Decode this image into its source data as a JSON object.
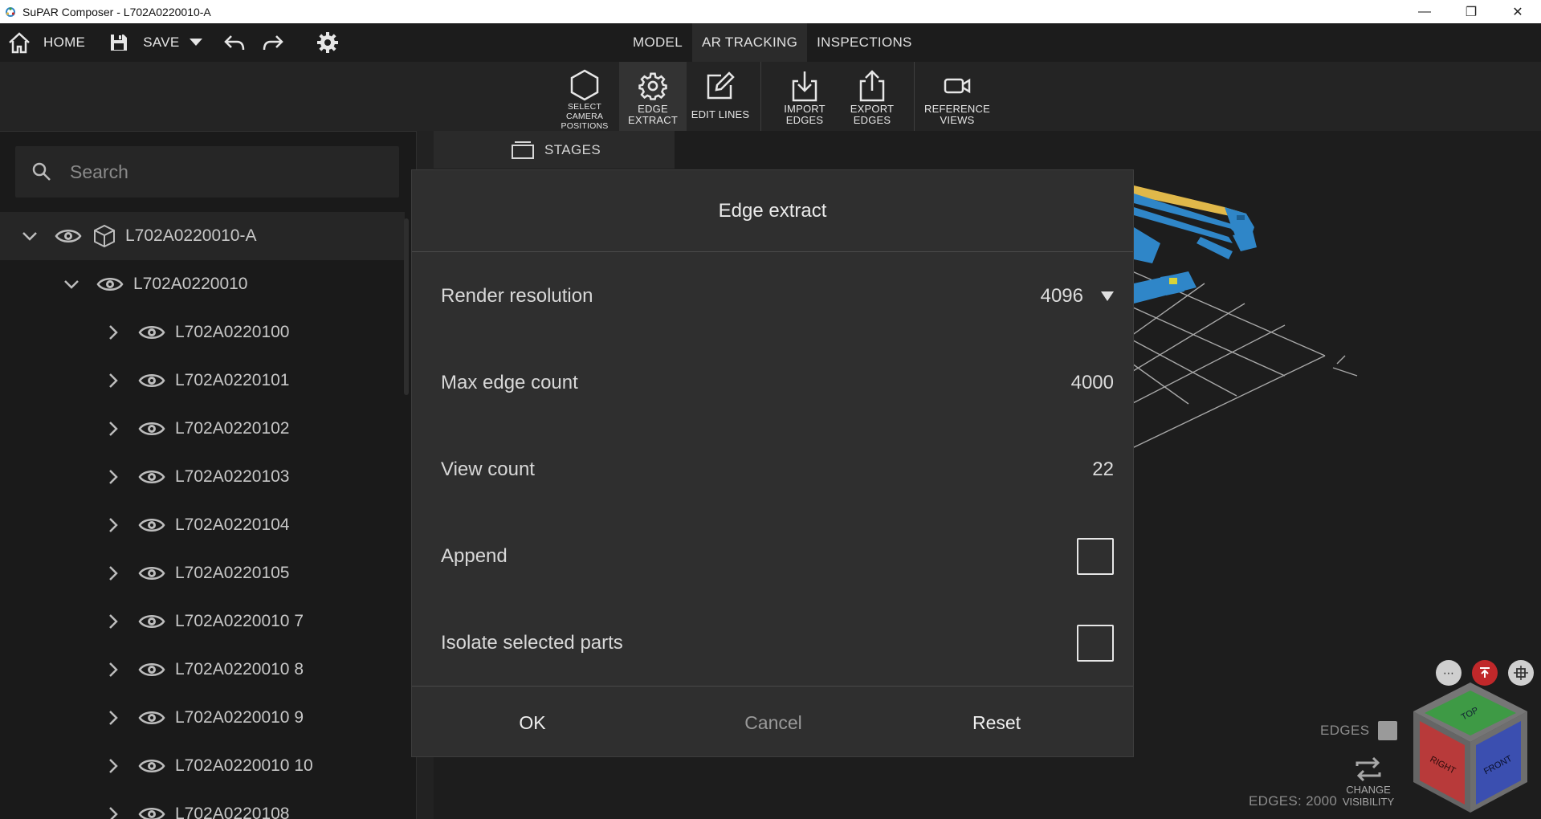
{
  "window": {
    "title": "SuPAR Composer - L702A0220010-A",
    "minimize": "—",
    "maximize": "❐",
    "close": "✕"
  },
  "menubar": {
    "home_label": "HOME",
    "save_label": "SAVE",
    "tabs": [
      {
        "label": "MODEL",
        "active": false
      },
      {
        "label": "AR TRACKING",
        "active": true
      },
      {
        "label": "INSPECTIONS",
        "active": false
      }
    ]
  },
  "toolbar": {
    "tools": [
      {
        "line1": "SELECT CAMERA",
        "line2": "POSITIONS",
        "icon": "hexagon-icon"
      },
      {
        "line1": "EDGE",
        "line2": "EXTRACT",
        "icon": "gear-icon"
      },
      {
        "line1": "EDIT LINES",
        "line2": "",
        "icon": "edit-icon"
      },
      {
        "line1": "IMPORT",
        "line2": "EDGES",
        "icon": "import-icon"
      },
      {
        "line1": "EXPORT",
        "line2": "EDGES",
        "icon": "export-icon"
      },
      {
        "line1": "REFERENCE",
        "line2": "VIEWS",
        "icon": "camera-icon"
      }
    ]
  },
  "search": {
    "placeholder": "Search"
  },
  "tree": {
    "items": [
      {
        "label": "L702A0220010-A",
        "level": 0,
        "expanded": true
      },
      {
        "label": "L702A0220010",
        "level": 1,
        "expanded": true
      },
      {
        "label": "L702A0220100",
        "level": 2,
        "expanded": false
      },
      {
        "label": "L702A0220101",
        "level": 2,
        "expanded": false
      },
      {
        "label": "L702A0220102",
        "level": 2,
        "expanded": false
      },
      {
        "label": "L702A0220103",
        "level": 2,
        "expanded": false
      },
      {
        "label": "L702A0220104",
        "level": 2,
        "expanded": false
      },
      {
        "label": "L702A0220105",
        "level": 2,
        "expanded": false
      },
      {
        "label": "L702A0220010 7",
        "level": 2,
        "expanded": false
      },
      {
        "label": "L702A0220010 8",
        "level": 2,
        "expanded": false
      },
      {
        "label": "L702A0220010 9",
        "level": 2,
        "expanded": false
      },
      {
        "label": "L702A0220010 10",
        "level": 2,
        "expanded": false
      },
      {
        "label": "L702A0220108",
        "level": 2,
        "expanded": false
      }
    ]
  },
  "viewport": {
    "stages_label": "STAGES",
    "edges_toggle_label": "EDGES",
    "change_visibility_line1": "CHANGE",
    "change_visibility_line2": "VISIBILITY",
    "edges_count": "EDGES: 2000",
    "navcube": {
      "top": "TOP",
      "right": "RIGHT",
      "front": "FRONT"
    }
  },
  "dialog": {
    "title": "Edge extract",
    "render_resolution_label": "Render resolution",
    "render_resolution_value": "4096",
    "max_edge_count_label": "Max edge count",
    "max_edge_count_value": "4000",
    "view_count_label": "View count",
    "view_count_value": "22",
    "append_label": "Append",
    "append_checked": false,
    "isolate_label": "Isolate selected parts",
    "isolate_checked": false,
    "ok_label": "OK",
    "cancel_label": "Cancel",
    "reset_label": "Reset"
  },
  "colors": {
    "accent_blue": "#2f86c8",
    "accent_yellow": "#e0b84a",
    "danger_red": "#c0282a",
    "navcube_green": "#3e9a45",
    "navcube_red": "#b83a3a",
    "navcube_blue": "#3b4fb0"
  }
}
